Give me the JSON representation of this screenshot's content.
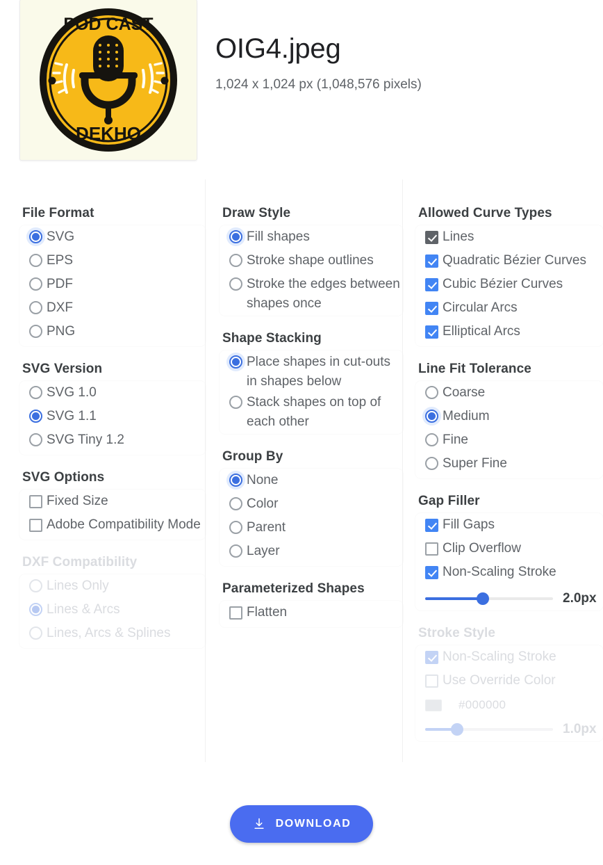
{
  "header": {
    "thumbnail_alt": "podcast-dekho-logo-thumbnail",
    "title": "OIG4.jpeg",
    "meta": "1,024 x 1,024 px (1,048,576 pixels)",
    "logo": {
      "top_text": "POD CAST",
      "bottom_text": "DEKHO",
      "background": "#FAFAEA",
      "disc_color": "#F7B918",
      "ink_color": "#16140F"
    }
  },
  "columns": [
    {
      "name": "column-1",
      "sections": [
        {
          "title": "File Format",
          "control": "radio",
          "disabled": false,
          "options": [
            {
              "label": "SVG",
              "selected": true,
              "focused": true
            },
            {
              "label": "EPS",
              "selected": false
            },
            {
              "label": "PDF",
              "selected": false
            },
            {
              "label": "DXF",
              "selected": false
            },
            {
              "label": "PNG",
              "selected": false
            }
          ]
        },
        {
          "title": "SVG Version",
          "control": "radio",
          "disabled": false,
          "options": [
            {
              "label": "SVG 1.0",
              "selected": false
            },
            {
              "label": "SVG 1.1",
              "selected": true
            },
            {
              "label": "SVG Tiny 1.2",
              "selected": false
            }
          ]
        },
        {
          "title": "SVG Options",
          "control": "checkbox",
          "disabled": false,
          "options": [
            {
              "label": "Fixed Size",
              "checked": false
            },
            {
              "label": "Adobe Compatibility Mode",
              "checked": false
            }
          ]
        },
        {
          "title": "DXF Compatibility",
          "control": "radio",
          "disabled": true,
          "options": [
            {
              "label": "Lines Only",
              "selected": false
            },
            {
              "label": "Lines & Arcs",
              "selected": true
            },
            {
              "label": "Lines, Arcs & Splines",
              "selected": false
            }
          ]
        }
      ]
    },
    {
      "name": "column-2",
      "sections": [
        {
          "title": "Draw Style",
          "control": "radio",
          "disabled": false,
          "options": [
            {
              "label": "Fill shapes",
              "selected": true,
              "focused": true
            },
            {
              "label": "Stroke shape outlines",
              "selected": false
            },
            {
              "label": "Stroke the edges between shapes once",
              "selected": false
            }
          ]
        },
        {
          "title": "Shape Stacking",
          "control": "radio",
          "disabled": false,
          "options": [
            {
              "label": "Place shapes in cut-outs in shapes below",
              "selected": true,
              "focused": true
            },
            {
              "label": "Stack shapes on top of each other",
              "selected": false
            }
          ]
        },
        {
          "title": "Group By",
          "control": "radio",
          "disabled": false,
          "options": [
            {
              "label": "None",
              "selected": true,
              "focused": true
            },
            {
              "label": "Color",
              "selected": false
            },
            {
              "label": "Parent",
              "selected": false
            },
            {
              "label": "Layer",
              "selected": false
            }
          ]
        },
        {
          "title": "Parameterized Shapes",
          "control": "checkbox",
          "disabled": false,
          "options": [
            {
              "label": "Flatten",
              "checked": false
            }
          ]
        }
      ]
    },
    {
      "name": "column-3",
      "sections": [
        {
          "title": "Allowed Curve Types",
          "control": "checkbox",
          "disabled": false,
          "options": [
            {
              "label": "Lines",
              "checked": true,
              "locked": true
            },
            {
              "label": "Quadratic Bézier Curves",
              "checked": true
            },
            {
              "label": "Cubic Bézier Curves",
              "checked": true
            },
            {
              "label": "Circular Arcs",
              "checked": true
            },
            {
              "label": "Elliptical Arcs",
              "checked": true
            }
          ]
        },
        {
          "title": "Line Fit Tolerance",
          "control": "radio",
          "disabled": false,
          "options": [
            {
              "label": "Coarse",
              "selected": false
            },
            {
              "label": "Medium",
              "selected": true,
              "focused": true
            },
            {
              "label": "Fine",
              "selected": false
            },
            {
              "label": "Super Fine",
              "selected": false
            }
          ]
        },
        {
          "title": "Gap Filler",
          "control": "checkbox",
          "disabled": false,
          "options": [
            {
              "label": "Fill Gaps",
              "checked": true
            },
            {
              "label": "Clip Overflow",
              "checked": false
            },
            {
              "label": "Non-Scaling Stroke",
              "checked": true
            }
          ],
          "slider": {
            "value_label": "2.0px",
            "percent": 45
          }
        },
        {
          "title": "Stroke Style",
          "control": "checkbox",
          "disabled": true,
          "options": [
            {
              "label": "Non-Scaling Stroke",
              "checked": true
            },
            {
              "label": "Use Override Color",
              "checked": false
            }
          ],
          "color": {
            "hex_label": "#000000",
            "swatch": "#e8eaed"
          },
          "slider": {
            "value_label": "1.0px",
            "percent": 25
          }
        }
      ]
    }
  ],
  "footer": {
    "download_label": "DOWNLOAD",
    "download_icon": "download-icon",
    "accent_color": "#4a6cf0"
  }
}
